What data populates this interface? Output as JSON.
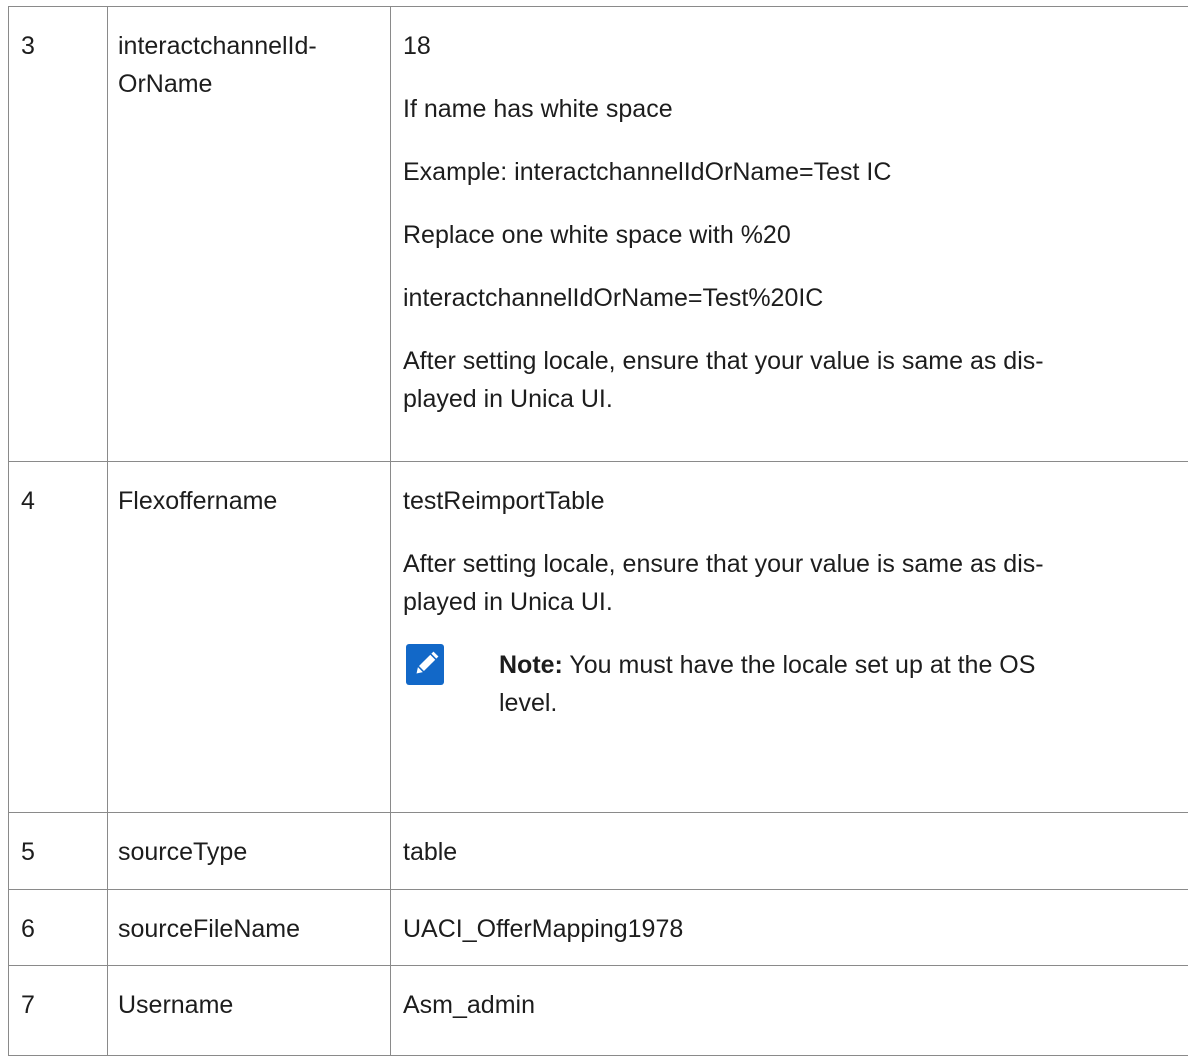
{
  "rows": [
    {
      "num": "3",
      "name_lines": [
        "interactchannelId-",
        "OrName"
      ],
      "value_paras": [
        "18",
        "If name has white space",
        "Example: interactchannelIdOrName=Test IC",
        "Replace one white space with %20",
        "interactchannelIdOrName=Test%20IC",
        [
          "After setting locale, ensure that your value is same as dis-",
          "played in Unica UI."
        ]
      ]
    },
    {
      "num": "4",
      "name": "Flexoffername",
      "value_paras": [
        "testReimportTable",
        [
          "After setting locale, ensure that your value is same as dis-",
          "played in Unica UI."
        ]
      ],
      "note": {
        "icon": "note-pencil-icon",
        "label": "Note:",
        "text_lines": [
          "You must have the locale set up at the OS",
          "level."
        ]
      }
    },
    {
      "num": "5",
      "name": "sourceType",
      "value": "table"
    },
    {
      "num": "6",
      "name": "sourceFileName",
      "value": "UACI_OfferMapping1978"
    },
    {
      "num": "7",
      "name": "Username",
      "value": "Asm_admin"
    }
  ],
  "colors": {
    "border": "#8a8a8a",
    "text": "#1d1d1d",
    "note_icon": "#1268c8"
  }
}
